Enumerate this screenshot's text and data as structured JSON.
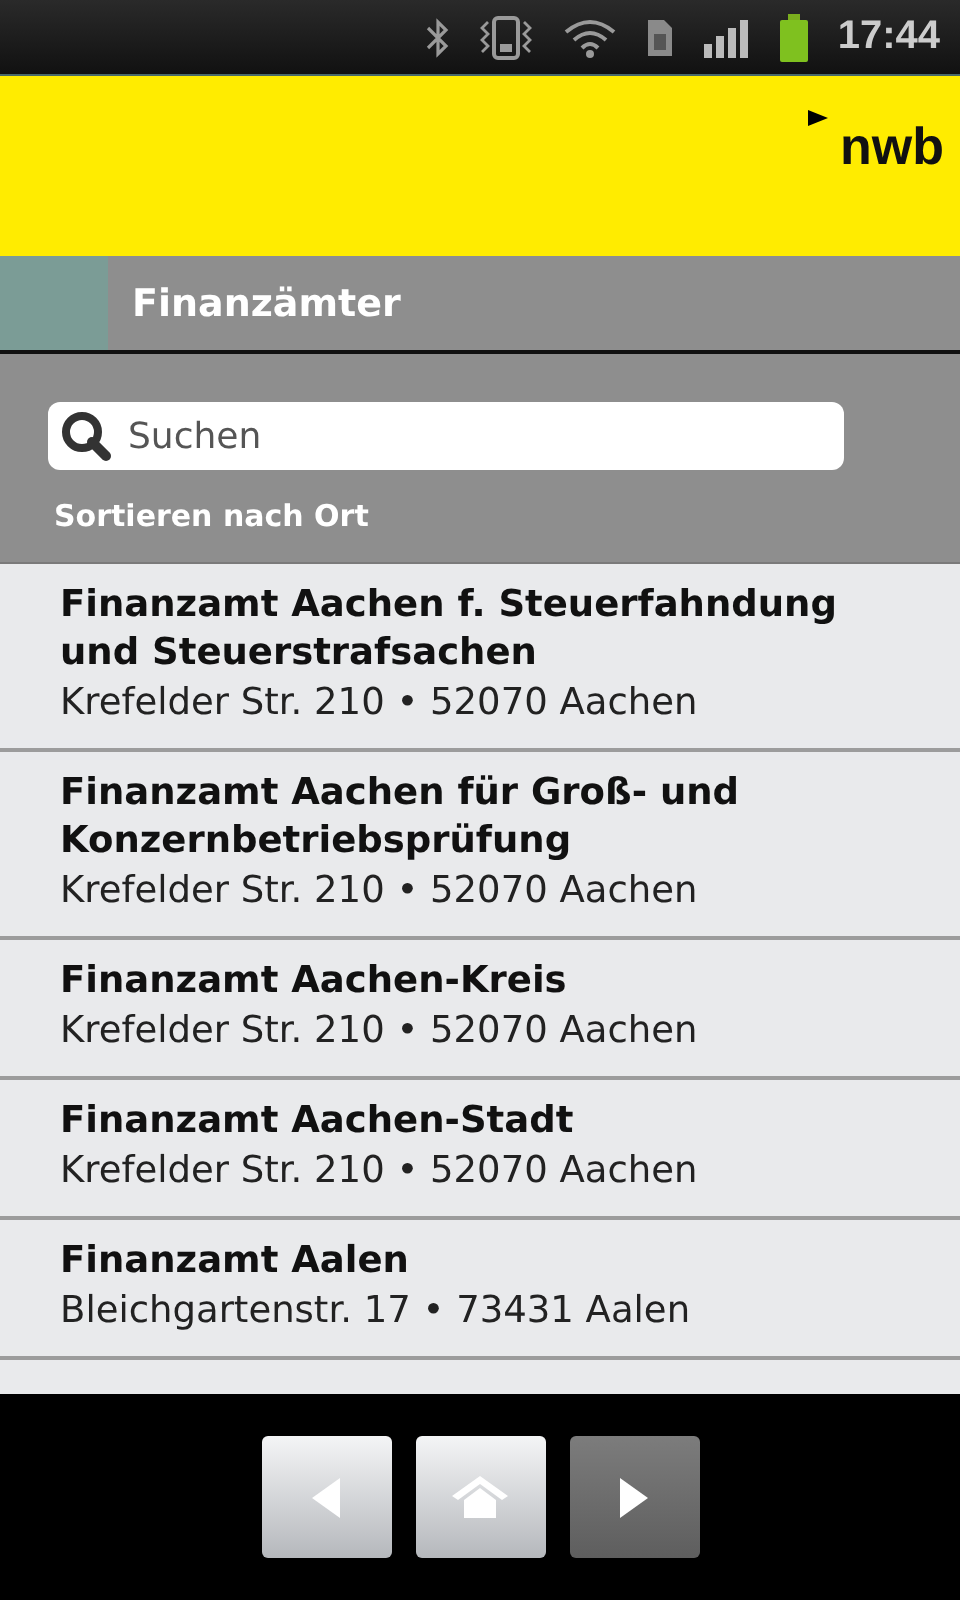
{
  "status_bar": {
    "time": "17:44"
  },
  "header": {
    "logo": "nwb"
  },
  "title_bar": {
    "title": "Finanzämter"
  },
  "search": {
    "placeholder": "Suchen"
  },
  "sort_label": "Sortieren nach Ort",
  "offices": [
    {
      "name": "Finanzamt Aachen f. Steuerfahndung und Steuerstrafsachen",
      "address": "Krefelder Str. 210 • 52070 Aachen"
    },
    {
      "name": "Finanzamt Aachen für Groß- und Konzernbetriebsprüfung",
      "address": "Krefelder Str. 210 • 52070 Aachen"
    },
    {
      "name": "Finanzamt Aachen-Kreis",
      "address": "Krefelder Str. 210 • 52070 Aachen"
    },
    {
      "name": "Finanzamt Aachen-Stadt",
      "address": "Krefelder Str. 210 • 52070 Aachen"
    },
    {
      "name": "Finanzamt Aalen",
      "address": "Bleichgartenstr. 17 • 73431 Aalen"
    }
  ],
  "nav_buttons": [
    {
      "kind": "back",
      "disabled": false
    },
    {
      "kind": "home",
      "disabled": false
    },
    {
      "kind": "forward",
      "disabled": true
    }
  ]
}
